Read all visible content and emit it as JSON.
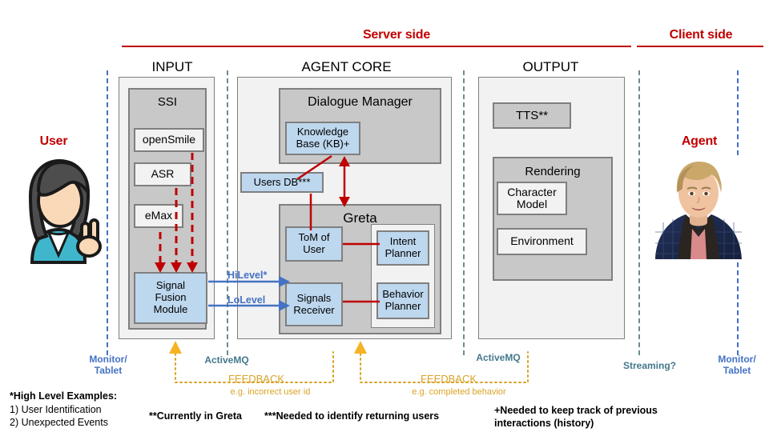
{
  "header": {
    "server_side": "Server side",
    "client_side": "Client side"
  },
  "columns": {
    "input": "INPUT",
    "agent_core": "AGENT CORE",
    "output": "OUTPUT"
  },
  "actors": {
    "user_label": "User",
    "agent_label": "Agent"
  },
  "input": {
    "ssi_title": "SSI",
    "modules": [
      {
        "label": "openSmile"
      },
      {
        "label": "ASR"
      },
      {
        "label": "eMax"
      }
    ],
    "fusion": "Signal\nFusion\nModule"
  },
  "agent_core": {
    "dialogue_manager_title": "Dialogue Manager",
    "knowledge_base": "Knowledge\nBase (KB)+",
    "users_db": "Users DB***",
    "greta_title": "Greta",
    "tom_of_user": "ToM of\nUser",
    "signals_receiver": "Signals\nReceiver",
    "intent_planner": "Intent\nPlanner",
    "behavior_planner": "Behavior\nPlanner"
  },
  "output": {
    "tts": "TTS**",
    "rendering_title": "Rendering",
    "character_model": "Character\nModel",
    "environment": "Environment"
  },
  "connectors": {
    "hilevel": "HiLevel*",
    "lolevel": "LoLevel"
  },
  "captions": {
    "monitor_tablet_left": "Monitor/\nTablet",
    "monitor_tablet_right": "Monitor/\nTablet",
    "activemq_left": "ActiveMQ",
    "activemq_right": "ActiveMQ",
    "streaming": "Streaming?"
  },
  "feedback": {
    "left_title": "FEEDBACK",
    "left_sub": "e.g. incorrect user id",
    "right_title": "FEEDBACK",
    "right_sub": "e.g. completed behavior"
  },
  "footnotes": {
    "high_level_title": "*High Level Examples:",
    "high_level_1": "1) User Identification",
    "high_level_2": "2) Unexpected Events",
    "currently_in_greta": "**Currently in Greta",
    "returning_users": "***Needed to identify returning users",
    "history_line1": "+Needed to keep track of previous",
    "history_line2": "interactions (history)"
  },
  "colors": {
    "red_accent": "#c00000",
    "blue_box": "#bdd7ee",
    "blue_line": "#4472c4",
    "teal_line": "#6e8c91",
    "gold": "#d9a326",
    "gray_box": "#c8c8c8",
    "panel": "#f2f2f2"
  }
}
